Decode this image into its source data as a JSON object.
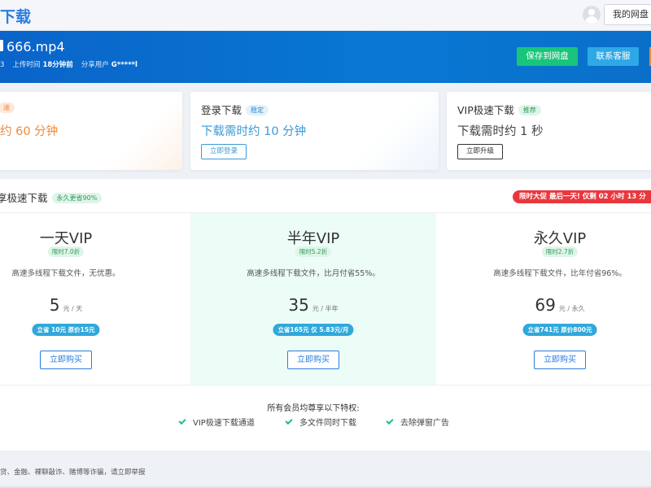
{
  "header": {
    "title": "下载",
    "my_disk_label": "我的网盘"
  },
  "file": {
    "name": "666.mp4",
    "size_fragment": "3",
    "upload_label": "上传时间",
    "upload_value": "18分钟前",
    "sharer_label": "分享用户",
    "sharer_value": "G*****l",
    "save_button": "保存到网盘",
    "support_button": "联系客服"
  },
  "tiers": [
    {
      "badge": "速",
      "time": "约 60 分钟"
    },
    {
      "title": "登录下载",
      "badge": "稳定",
      "time": "下载需时约 10 分钟",
      "button": "立即登录"
    },
    {
      "title": "VIP极速下载",
      "badge": "推荐",
      "time": "下载需时约 1 秒",
      "button": "立即升级"
    }
  ],
  "vip": {
    "title": "享极速下载",
    "title_badge": "永久更省90%",
    "promo": "限时大促 最后一天! 仅剩 02 小时 13 分",
    "plans": [
      {
        "name": "一天VIP",
        "discount": "限时7.0折",
        "desc": "高速多线程下载文件，无优惠。",
        "price": "5",
        "unit": "元 / 天",
        "save": "立省 10元 原价15元",
        "buy": "立即购买"
      },
      {
        "name": "半年VIP",
        "discount": "限时5.2折",
        "desc": "高速多线程下载文件，比月付省55%。",
        "price": "35",
        "unit": "元 / 半年",
        "save": "立省165元 仅 5.83元/月",
        "buy": "立即购买"
      },
      {
        "name": "永久VIP",
        "discount": "限时2.7折",
        "desc": "高速多线程下载文件，比年付省96%。",
        "price": "69",
        "unit": "元 / 永久",
        "save": "立省741元 原价800元",
        "buy": "立即购买"
      }
    ],
    "privileges_title": "所有会员均尊享以下特权:",
    "privileges": [
      "VIP极速下载通道",
      "多文件同时下载",
      "去除弹窗广告"
    ]
  },
  "footer": {
    "note": "贷、金融、裸聊敲诈、赌博等诈骗，请立即举报"
  },
  "colors": {
    "brand_blue": "#2b7de0",
    "save_green": "#18c57a",
    "support_blue": "#2ea8e6",
    "slow_orange": "#f08a3e",
    "login_blue": "#3a9bd8",
    "promo_red": "#e8383d"
  }
}
